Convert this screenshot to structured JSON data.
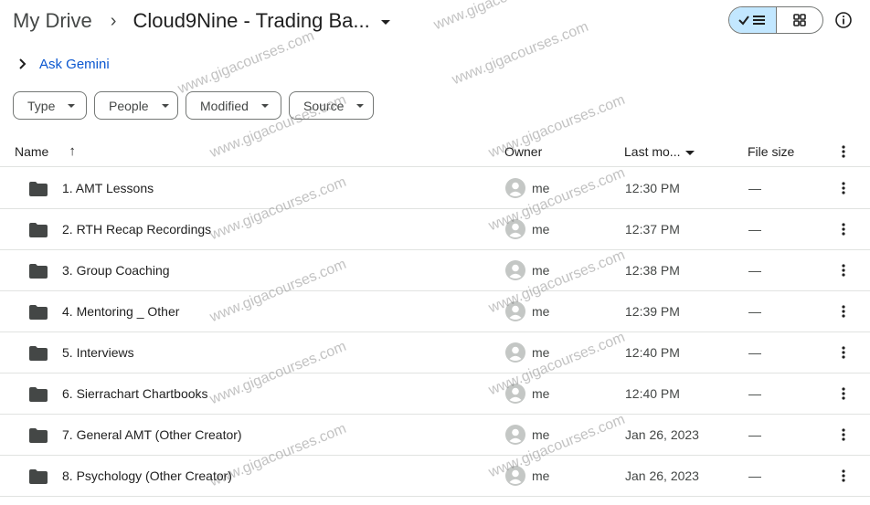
{
  "breadcrumb": {
    "root": "My Drive",
    "separator": "›",
    "current": "Cloud9Nine - Trading Ba..."
  },
  "icons": {
    "list_view": "check-list-icon",
    "grid_view": "grid-icon",
    "info": "info-icon",
    "folder": "folder-icon",
    "avatar": "person-avatar-icon",
    "more": "more-vert-icon",
    "sort": "arrow-up-icon"
  },
  "colors": {
    "active_view_bg": "#c2e7ff",
    "gemini_link": "#0b57d0",
    "folder": "#444746"
  },
  "gemini": {
    "label": "Ask Gemini"
  },
  "filters": [
    {
      "label": "Type"
    },
    {
      "label": "People"
    },
    {
      "label": "Modified"
    },
    {
      "label": "Source"
    }
  ],
  "columns": {
    "name": "Name",
    "sort_arrow": "↑",
    "owner": "Owner",
    "last_modified": "Last mo...",
    "file_size": "File size"
  },
  "rows": [
    {
      "name": "1. AMT Lessons",
      "owner": "me",
      "modified": "12:30 PM",
      "size": "—"
    },
    {
      "name": "2. RTH Recap Recordings",
      "owner": "me",
      "modified": "12:37 PM",
      "size": "—"
    },
    {
      "name": "3. Group Coaching",
      "owner": "me",
      "modified": "12:38 PM",
      "size": "—"
    },
    {
      "name": "4. Mentoring _ Other",
      "owner": "me",
      "modified": "12:39 PM",
      "size": "—"
    },
    {
      "name": "5. Interviews",
      "owner": "me",
      "modified": "12:40 PM",
      "size": "—"
    },
    {
      "name": "6. Sierrachart Chartbooks",
      "owner": "me",
      "modified": "12:40 PM",
      "size": "—"
    },
    {
      "name": "7. General AMT (Other Creator)",
      "owner": "me",
      "modified": "Jan 26, 2023",
      "size": "—"
    },
    {
      "name": "8. Psychology (Other Creator)",
      "owner": "me",
      "modified": "Jan 26, 2023",
      "size": "—"
    }
  ],
  "watermark": "www.gigacourses.com"
}
